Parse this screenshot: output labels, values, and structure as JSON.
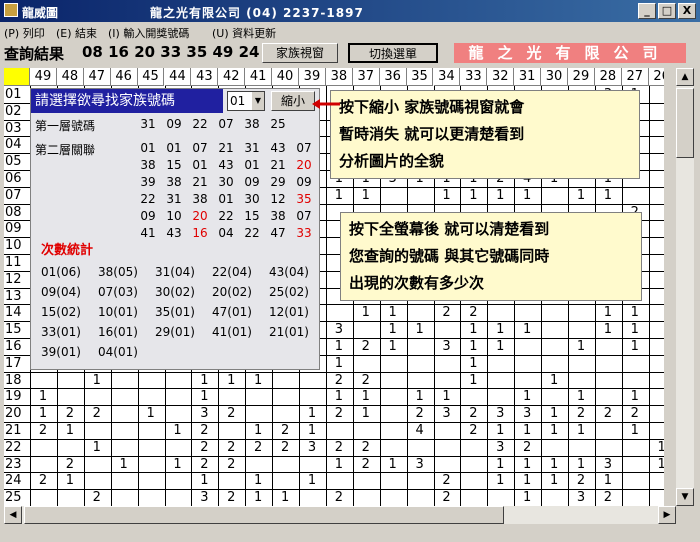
{
  "window": {
    "title": "龍威圖",
    "company_title": "龍之光有限公司 (04) 2237-1897",
    "btn_min": "_",
    "btn_max": "□",
    "btn_close": "X"
  },
  "menu": [
    "(P) 列印",
    "(E) 結束",
    "(I) 輸入開獎號碼",
    "(U) 資料更新"
  ],
  "toolbar": {
    "query_label": "查詢結果",
    "query_numbers": "08 16 20 33 35 49 24",
    "family_btn": "家族視窗",
    "switch_btn": "切換選單",
    "brand": "龍之光有限公司"
  },
  "grid": {
    "headers": [
      "",
      "49",
      "48",
      "47",
      "46",
      "45",
      "44",
      "43",
      "42",
      "41",
      "40",
      "39",
      "38",
      "37",
      "36",
      "35",
      "34",
      "33",
      "32",
      "31",
      "30",
      "29",
      "28",
      "27",
      "26"
    ],
    "rows": [
      "01",
      "02",
      "03",
      "04",
      "05",
      "06",
      "07",
      "08",
      "09",
      "10",
      "11",
      "12",
      "13",
      "14",
      "15",
      "16",
      "17",
      "18",
      "19",
      "20",
      "21",
      "22",
      "23",
      "24",
      "25"
    ],
    "cells": [
      {
        "r": 0,
        "c": 22,
        "v": "3"
      },
      {
        "r": 0,
        "c": 23,
        "v": "1"
      },
      {
        "r": 5,
        "c": 12,
        "v": "1"
      },
      {
        "r": 5,
        "c": 13,
        "v": "1"
      },
      {
        "r": 5,
        "c": 14,
        "v": "3"
      },
      {
        "r": 5,
        "c": 15,
        "v": "1"
      },
      {
        "r": 5,
        "c": 16,
        "v": "1"
      },
      {
        "r": 5,
        "c": 17,
        "v": "1"
      },
      {
        "r": 5,
        "c": 18,
        "v": "2"
      },
      {
        "r": 5,
        "c": 19,
        "v": "4"
      },
      {
        "r": 5,
        "c": 20,
        "v": "1"
      },
      {
        "r": 5,
        "c": 22,
        "v": "1"
      },
      {
        "r": 6,
        "c": 12,
        "v": "1"
      },
      {
        "r": 6,
        "c": 13,
        "v": "1"
      },
      {
        "r": 6,
        "c": 16,
        "v": "1"
      },
      {
        "r": 6,
        "c": 17,
        "v": "1"
      },
      {
        "r": 6,
        "c": 18,
        "v": "1"
      },
      {
        "r": 6,
        "c": 19,
        "v": "1"
      },
      {
        "r": 6,
        "c": 21,
        "v": "1"
      },
      {
        "r": 6,
        "c": 22,
        "v": "1"
      },
      {
        "r": 7,
        "c": 23,
        "v": "2"
      },
      {
        "r": 13,
        "c": 13,
        "v": "1"
      },
      {
        "r": 13,
        "c": 14,
        "v": "1"
      },
      {
        "r": 13,
        "c": 16,
        "v": "2"
      },
      {
        "r": 13,
        "c": 17,
        "v": "2"
      },
      {
        "r": 13,
        "c": 22,
        "v": "1"
      },
      {
        "r": 13,
        "c": 23,
        "v": "1"
      },
      {
        "r": 14,
        "c": 12,
        "v": "3"
      },
      {
        "r": 14,
        "c": 14,
        "v": "1"
      },
      {
        "r": 14,
        "c": 15,
        "v": "1"
      },
      {
        "r": 14,
        "c": 17,
        "v": "1"
      },
      {
        "r": 14,
        "c": 18,
        "v": "1"
      },
      {
        "r": 14,
        "c": 19,
        "v": "1"
      },
      {
        "r": 14,
        "c": 22,
        "v": "1"
      },
      {
        "r": 14,
        "c": 23,
        "v": "1"
      },
      {
        "r": 15,
        "c": 12,
        "v": "1"
      },
      {
        "r": 15,
        "c": 13,
        "v": "2"
      },
      {
        "r": 15,
        "c": 14,
        "v": "1"
      },
      {
        "r": 15,
        "c": 16,
        "v": "3"
      },
      {
        "r": 15,
        "c": 17,
        "v": "1"
      },
      {
        "r": 15,
        "c": 18,
        "v": "1"
      },
      {
        "r": 15,
        "c": 21,
        "v": "1"
      },
      {
        "r": 15,
        "c": 23,
        "v": "1"
      },
      {
        "r": 16,
        "c": 12,
        "v": "1"
      },
      {
        "r": 16,
        "c": 17,
        "v": "1"
      },
      {
        "r": 17,
        "c": 3,
        "v": "1"
      },
      {
        "r": 17,
        "c": 7,
        "v": "1"
      },
      {
        "r": 17,
        "c": 8,
        "v": "1"
      },
      {
        "r": 17,
        "c": 9,
        "v": "1"
      },
      {
        "r": 17,
        "c": 12,
        "v": "2"
      },
      {
        "r": 17,
        "c": 13,
        "v": "2"
      },
      {
        "r": 17,
        "c": 17,
        "v": "1"
      },
      {
        "r": 17,
        "c": 20,
        "v": "1"
      },
      {
        "r": 18,
        "c": 1,
        "v": "1"
      },
      {
        "r": 18,
        "c": 7,
        "v": "1"
      },
      {
        "r": 18,
        "c": 12,
        "v": "1"
      },
      {
        "r": 18,
        "c": 13,
        "v": "1"
      },
      {
        "r": 18,
        "c": 15,
        "v": "1"
      },
      {
        "r": 18,
        "c": 16,
        "v": "1"
      },
      {
        "r": 18,
        "c": 19,
        "v": "1"
      },
      {
        "r": 18,
        "c": 21,
        "v": "1"
      },
      {
        "r": 18,
        "c": 23,
        "v": "1"
      },
      {
        "r": 19,
        "c": 1,
        "v": "1"
      },
      {
        "r": 19,
        "c": 2,
        "v": "2"
      },
      {
        "r": 19,
        "c": 3,
        "v": "2"
      },
      {
        "r": 19,
        "c": 5,
        "v": "1"
      },
      {
        "r": 19,
        "c": 7,
        "v": "3"
      },
      {
        "r": 19,
        "c": 8,
        "v": "2"
      },
      {
        "r": 19,
        "c": 11,
        "v": "1"
      },
      {
        "r": 19,
        "c": 12,
        "v": "2"
      },
      {
        "r": 19,
        "c": 13,
        "v": "1"
      },
      {
        "r": 19,
        "c": 15,
        "v": "2"
      },
      {
        "r": 19,
        "c": 16,
        "v": "3"
      },
      {
        "r": 19,
        "c": 17,
        "v": "2"
      },
      {
        "r": 19,
        "c": 18,
        "v": "3"
      },
      {
        "r": 19,
        "c": 19,
        "v": "3"
      },
      {
        "r": 19,
        "c": 20,
        "v": "1"
      },
      {
        "r": 19,
        "c": 21,
        "v": "2"
      },
      {
        "r": 19,
        "c": 22,
        "v": "2"
      },
      {
        "r": 19,
        "c": 23,
        "v": "2"
      },
      {
        "r": 20,
        "c": 1,
        "v": "2"
      },
      {
        "r": 20,
        "c": 2,
        "v": "1"
      },
      {
        "r": 20,
        "c": 6,
        "v": "1"
      },
      {
        "r": 20,
        "c": 7,
        "v": "2"
      },
      {
        "r": 20,
        "c": 9,
        "v": "1"
      },
      {
        "r": 20,
        "c": 10,
        "v": "2"
      },
      {
        "r": 20,
        "c": 11,
        "v": "1"
      },
      {
        "r": 20,
        "c": 15,
        "v": "4"
      },
      {
        "r": 20,
        "c": 17,
        "v": "2"
      },
      {
        "r": 20,
        "c": 18,
        "v": "1"
      },
      {
        "r": 20,
        "c": 19,
        "v": "1"
      },
      {
        "r": 20,
        "c": 20,
        "v": "1"
      },
      {
        "r": 20,
        "c": 21,
        "v": "1"
      },
      {
        "r": 20,
        "c": 23,
        "v": "1"
      },
      {
        "r": 21,
        "c": 3,
        "v": "1"
      },
      {
        "r": 21,
        "c": 7,
        "v": "2"
      },
      {
        "r": 21,
        "c": 8,
        "v": "2"
      },
      {
        "r": 21,
        "c": 9,
        "v": "2"
      },
      {
        "r": 21,
        "c": 10,
        "v": "2"
      },
      {
        "r": 21,
        "c": 11,
        "v": "3"
      },
      {
        "r": 21,
        "c": 12,
        "v": "2"
      },
      {
        "r": 21,
        "c": 13,
        "v": "2"
      },
      {
        "r": 21,
        "c": 18,
        "v": "3"
      },
      {
        "r": 21,
        "c": 19,
        "v": "2"
      },
      {
        "r": 21,
        "c": 24,
        "v": "1"
      },
      {
        "r": 22,
        "c": 2,
        "v": "2"
      },
      {
        "r": 22,
        "c": 4,
        "v": "1"
      },
      {
        "r": 22,
        "c": 6,
        "v": "1"
      },
      {
        "r": 22,
        "c": 7,
        "v": "2"
      },
      {
        "r": 22,
        "c": 8,
        "v": "2"
      },
      {
        "r": 22,
        "c": 12,
        "v": "1"
      },
      {
        "r": 22,
        "c": 13,
        "v": "2"
      },
      {
        "r": 22,
        "c": 14,
        "v": "1"
      },
      {
        "r": 22,
        "c": 15,
        "v": "3"
      },
      {
        "r": 22,
        "c": 18,
        "v": "1"
      },
      {
        "r": 22,
        "c": 19,
        "v": "1"
      },
      {
        "r": 22,
        "c": 20,
        "v": "1"
      },
      {
        "r": 22,
        "c": 21,
        "v": "1"
      },
      {
        "r": 22,
        "c": 22,
        "v": "3"
      },
      {
        "r": 22,
        "c": 24,
        "v": "1"
      },
      {
        "r": 23,
        "c": 1,
        "v": "2"
      },
      {
        "r": 23,
        "c": 2,
        "v": "1"
      },
      {
        "r": 23,
        "c": 7,
        "v": "1"
      },
      {
        "r": 23,
        "c": 9,
        "v": "1"
      },
      {
        "r": 23,
        "c": 11,
        "v": "1"
      },
      {
        "r": 23,
        "c": 16,
        "v": "2"
      },
      {
        "r": 23,
        "c": 18,
        "v": "1"
      },
      {
        "r": 23,
        "c": 19,
        "v": "1"
      },
      {
        "r": 23,
        "c": 20,
        "v": "1"
      },
      {
        "r": 23,
        "c": 21,
        "v": "2"
      },
      {
        "r": 23,
        "c": 22,
        "v": "1"
      },
      {
        "r": 24,
        "c": 3,
        "v": "2"
      },
      {
        "r": 24,
        "c": 7,
        "v": "3"
      },
      {
        "r": 24,
        "c": 8,
        "v": "2"
      },
      {
        "r": 24,
        "c": 9,
        "v": "1"
      },
      {
        "r": 24,
        "c": 10,
        "v": "1"
      },
      {
        "r": 24,
        "c": 12,
        "v": "2"
      },
      {
        "r": 24,
        "c": 16,
        "v": "2"
      },
      {
        "r": 24,
        "c": 19,
        "v": "1"
      },
      {
        "r": 24,
        "c": 21,
        "v": "3"
      },
      {
        "r": 24,
        "c": 22,
        "v": "2"
      }
    ]
  },
  "panel": {
    "heading": "請選擇欲尋找家族號碼",
    "select_value": "01",
    "shrink_btn": "縮小",
    "layer1_label": "第一層號碼",
    "layer1": [
      "31",
      "09",
      "22",
      "07",
      "38",
      "25"
    ],
    "layer2_label": "第二層關聯",
    "layer2": [
      [
        {
          "t": "01",
          "red": false
        },
        {
          "t": "38",
          "red": false
        },
        {
          "t": "39",
          "red": false
        },
        {
          "t": "22",
          "red": false
        },
        {
          "t": "09",
          "red": false
        },
        {
          "t": "41",
          "red": false
        }
      ],
      [
        {
          "t": "01",
          "red": false
        },
        {
          "t": "15",
          "red": false
        },
        {
          "t": "38",
          "red": false
        },
        {
          "t": "31",
          "red": false
        },
        {
          "t": "10",
          "red": false
        },
        {
          "t": "43",
          "red": false
        }
      ],
      [
        {
          "t": "07",
          "red": false
        },
        {
          "t": "01",
          "red": false
        },
        {
          "t": "21",
          "red": false
        },
        {
          "t": "38",
          "red": false
        },
        {
          "t": "20",
          "red": true
        },
        {
          "t": "16",
          "red": true
        }
      ],
      [
        {
          "t": "21",
          "red": false
        },
        {
          "t": "43",
          "red": false
        },
        {
          "t": "30",
          "red": false
        },
        {
          "t": "01",
          "red": false
        },
        {
          "t": "22",
          "red": false
        },
        {
          "t": "04",
          "red": false
        }
      ],
      [
        {
          "t": "31",
          "red": false
        },
        {
          "t": "01",
          "red": false
        },
        {
          "t": "09",
          "red": false
        },
        {
          "t": "30",
          "red": false
        },
        {
          "t": "15",
          "red": false
        },
        {
          "t": "22",
          "red": false
        }
      ],
      [
        {
          "t": "43",
          "red": false
        },
        {
          "t": "21",
          "red": false
        },
        {
          "t": "29",
          "red": false
        },
        {
          "t": "12",
          "red": false
        },
        {
          "t": "38",
          "red": false
        },
        {
          "t": "47",
          "red": false
        }
      ],
      [
        {
          "t": "07",
          "red": false
        },
        {
          "t": "20",
          "red": true
        },
        {
          "t": "09",
          "red": false
        },
        {
          "t": "35",
          "red": true
        },
        {
          "t": "07",
          "red": false
        },
        {
          "t": "33",
          "red": true
        }
      ]
    ],
    "stats_title": "次數統計",
    "stats": [
      [
        {
          "t": "01(06)",
          "red": false
        },
        {
          "t": "38(05)",
          "red": false
        },
        {
          "t": "31(04)",
          "red": false
        },
        {
          "t": "22(04)",
          "red": false
        },
        {
          "t": "43(04)",
          "red": false
        }
      ],
      [
        {
          "t": "09(04)",
          "red": false
        },
        {
          "t": "07(03)",
          "red": false
        },
        {
          "t": "30(02)",
          "red": false
        },
        {
          "t": "20(02)",
          "red": true
        },
        {
          "t": "25(02)",
          "red": false
        }
      ],
      [
        {
          "t": "15(02)",
          "red": false
        },
        {
          "t": "10(01)",
          "red": false
        },
        {
          "t": "35(01)",
          "red": true
        },
        {
          "t": "47(01)",
          "red": false
        },
        {
          "t": "12(01)",
          "red": false
        }
      ],
      [
        {
          "t": "33(01)",
          "red": true
        },
        {
          "t": "16(01)",
          "red": true
        },
        {
          "t": "29(01)",
          "red": false
        },
        {
          "t": "41(01)",
          "red": false
        },
        {
          "t": "21(01)",
          "red": false
        }
      ],
      [
        {
          "t": "39(01)",
          "red": false
        },
        {
          "t": "04(01)",
          "red": false
        }
      ]
    ]
  },
  "notes": {
    "note1": [
      "按下縮小 家族號碼視窗就會",
      "暫時消失 就可以更清楚看到",
      "分析圖片的全貌"
    ],
    "note2": [
      "按下全螢幕後 就可以清楚看到",
      "您查詢的號碼 與其它號碼同時",
      "出現的次數有多少次"
    ]
  },
  "colors": {
    "title_bar": "#0a246a",
    "panel_head": "#2020a0",
    "brand": "#f08080",
    "highlight": "#e00000",
    "note_bg": "#fffacd"
  }
}
